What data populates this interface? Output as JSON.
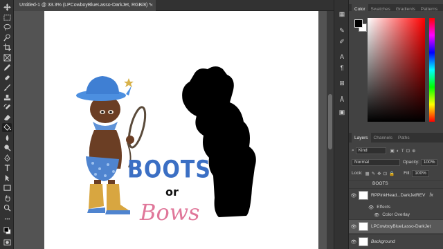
{
  "document": {
    "tab_title": "Untitled-1 @ 33.3% (LPCowboyBlueLasso-DarkJet, RGB/8) *",
    "close_glyph": "×"
  },
  "artwork": {
    "line1": "BOOTS",
    "line2": "or",
    "line3": "Bows",
    "boots_color": "#3b6fc4",
    "bows_color": "#e0779a"
  },
  "color_panel": {
    "tabs": [
      "Color",
      "Swatches",
      "Gradients",
      "Patterns"
    ],
    "active_tab": "Color",
    "foreground": "#000000",
    "background": "#ffffff"
  },
  "layers_panel": {
    "tabs": [
      "Layers",
      "Channels",
      "Paths"
    ],
    "active_tab": "Layers",
    "filter_kind": "Kind",
    "blend_mode": "Normal",
    "opacity_label": "Opacity:",
    "opacity_value": "100%",
    "lock_label": "Lock:",
    "fill_label": "Fill:",
    "fill_value": "100%",
    "layers": [
      {
        "name": "BOOTS",
        "selected": false
      },
      {
        "name": "RPPinkHead...DarkJetREV",
        "selected": false,
        "fx": "fx"
      },
      {
        "name": "LPCowboyBlueLasso-DarkJet",
        "selected": true
      },
      {
        "name": "Background",
        "selected": false
      }
    ],
    "effects_label": "Effects",
    "effect_item": "Color Overlay"
  },
  "toolbar": {
    "tools": [
      "move-tool",
      "artboard-tool",
      "lasso-tool",
      "quick-select-tool",
      "crop-tool",
      "frame-tool",
      "eyedropper-tool",
      "healing-brush-tool",
      "brush-tool",
      "clone-stamp-tool",
      "history-brush-tool",
      "eraser-tool",
      "paint-bucket-tool",
      "blur-tool",
      "dodge-tool",
      "pen-tool",
      "type-tool",
      "path-select-tool",
      "rectangle-tool",
      "hand-tool",
      "zoom-tool"
    ]
  }
}
